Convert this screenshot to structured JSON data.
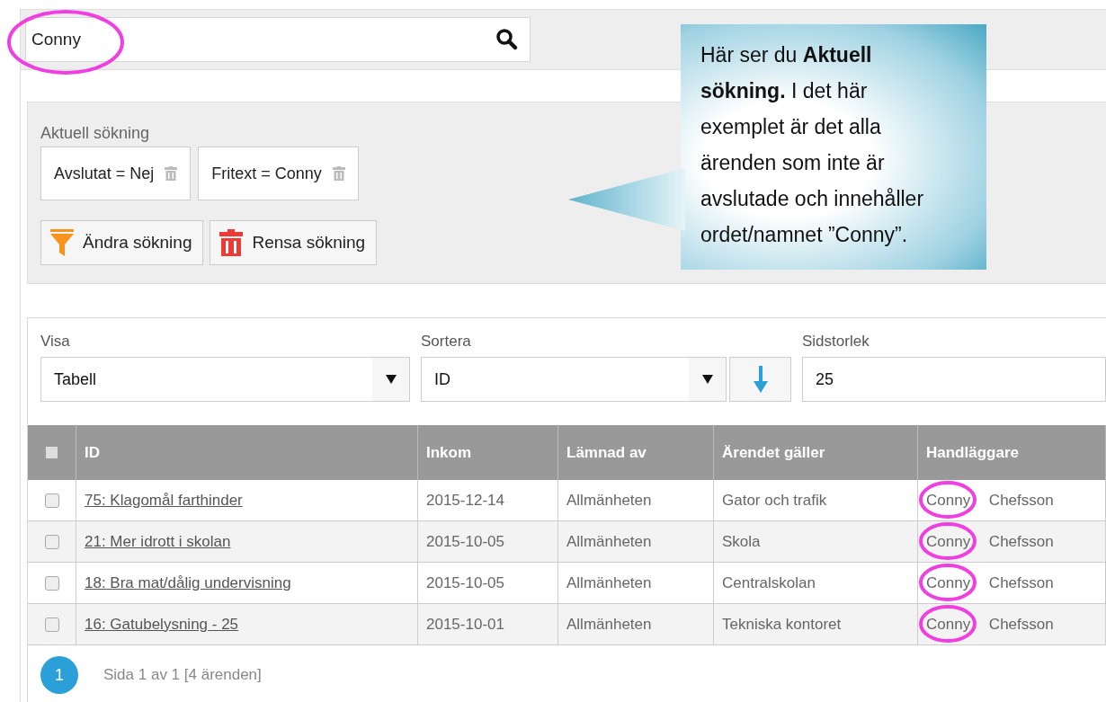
{
  "search": {
    "value": "Conny",
    "circled": true
  },
  "current_search": {
    "label": "Aktuell sökning",
    "filters": [
      "Avslutat = Nej",
      "Fritext = Conny"
    ],
    "buttons": [
      {
        "kind": "edit",
        "label": "Ändra sökning"
      },
      {
        "kind": "clear",
        "label": "Rensa sökning"
      }
    ]
  },
  "callout": {
    "text": "Här ser du **Aktuell sökning.** I det här exemplet är det alla ärenden som inte är avslutade och innehåller ordet/namnet ”Conny”."
  },
  "controls": {
    "view": {
      "label": "Visa",
      "value": "Tabell"
    },
    "sort": {
      "label": "Sortera",
      "value": "ID"
    },
    "page_size": {
      "label": "Sidstorlek",
      "value": "25"
    }
  },
  "table": {
    "select_all": false,
    "columns": [
      "ID",
      "Inkom",
      "Lämnad av",
      "Ärendet gäller",
      "Handläggare"
    ],
    "rows": [
      {
        "checked": false,
        "id": "75: Klagomål farthinder",
        "inkom": "2015-12-14",
        "lamnad_av": "Allmänheten",
        "arendet": "Gator och trafik",
        "handlaggare": "Conny Chefsson",
        "circled": true
      },
      {
        "checked": false,
        "id": "21: Mer idrott i skolan",
        "inkom": "2015-10-05",
        "lamnad_av": "Allmänheten",
        "arendet": "Skola",
        "handlaggare": "Conny Chefsson",
        "circled": true
      },
      {
        "checked": false,
        "id": "18: Bra mat/dålig undervisning",
        "inkom": "2015-10-05",
        "lamnad_av": "Allmänheten",
        "arendet": "Centralskolan",
        "handlaggare": "Conny Chefsson",
        "circled": true
      },
      {
        "checked": false,
        "id": "16: Gatubelysning - 25",
        "inkom": "2015-10-01",
        "lamnad_av": "Allmänheten",
        "arendet": "Tekniska kontoret",
        "handlaggare": "Conny Chefsson",
        "circled": true
      }
    ]
  },
  "pagination": {
    "pages": [
      {
        "label": "1",
        "selected": true
      }
    ],
    "summary": "Sida 1 av 1 [4 ärenden]"
  }
}
